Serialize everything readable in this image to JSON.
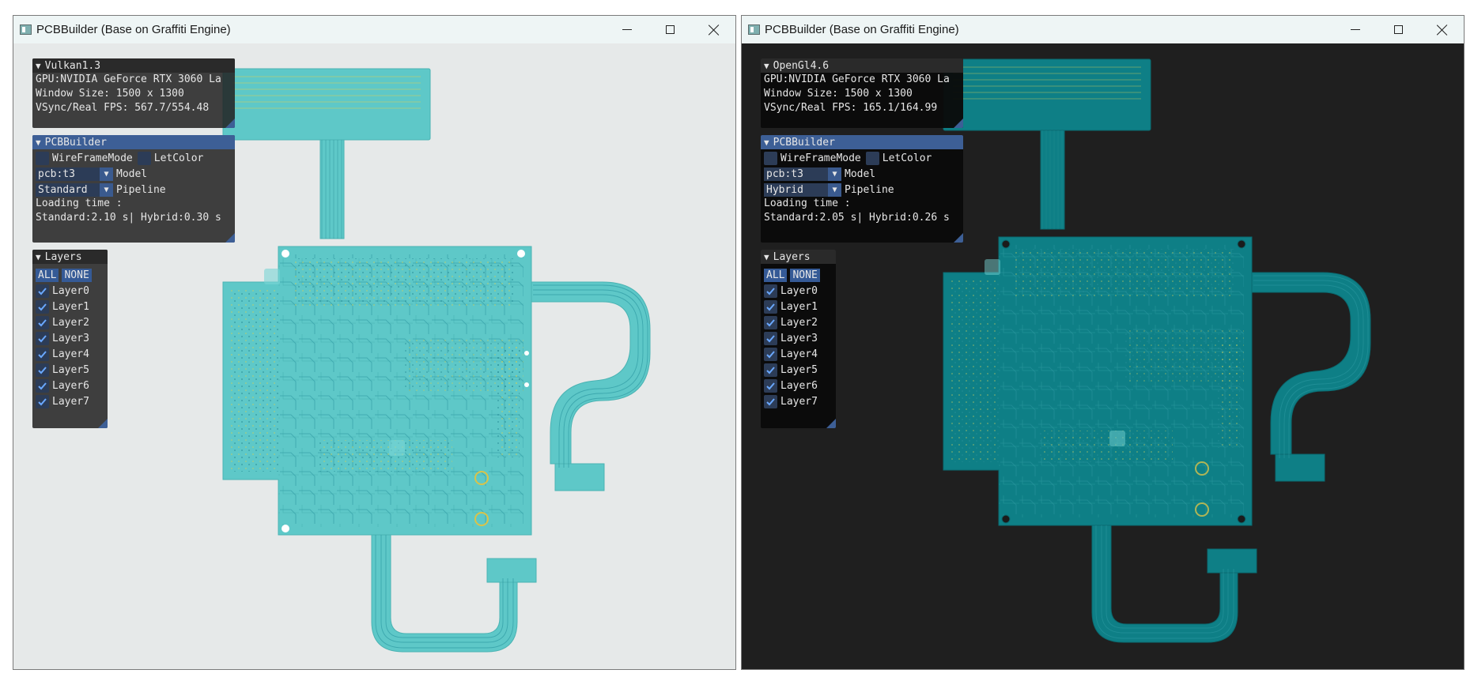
{
  "windows": [
    {
      "title": "PCBBuilder (Base on Graffiti Engine)",
      "theme": "light",
      "backend_panel": {
        "title": "Vulkan1.3",
        "gpu": "GPU:NVIDIA GeForce RTX 3060 La",
        "window_size": "Window Size: 1500 x 1300",
        "fps": "VSync/Real FPS: 567.7/554.48"
      },
      "pcb_panel": {
        "title": "PCBBuilder",
        "wireframe_label": "WireFrameMode",
        "letcolor_label": "LetColor",
        "model_value": "pcb:t3",
        "model_label": "Model",
        "pipeline_value": "Standard",
        "pipeline_label": "Pipeline",
        "loading_label": "Loading time :",
        "loading_value": "Standard:2.10 s| Hybrid:0.30 s"
      },
      "layers_panel": {
        "title": "Layers",
        "all_label": "ALL",
        "none_label": "NONE",
        "layers": [
          "Layer0",
          "Layer1",
          "Layer2",
          "Layer3",
          "Layer4",
          "Layer5",
          "Layer6",
          "Layer7"
        ]
      }
    },
    {
      "title": "PCBBuilder (Base on Graffiti Engine)",
      "theme": "dark",
      "backend_panel": {
        "title": "OpenGl4.6",
        "gpu": "GPU:NVIDIA GeForce RTX 3060 La",
        "window_size": "Window Size: 1500 x 1300",
        "fps": "VSync/Real FPS: 165.1/164.99"
      },
      "pcb_panel": {
        "title": "PCBBuilder",
        "wireframe_label": "WireFrameMode",
        "letcolor_label": "LetColor",
        "model_value": "pcb:t3",
        "model_label": "Model",
        "pipeline_value": "Hybrid",
        "pipeline_label": "Pipeline",
        "loading_label": "Loading time :",
        "loading_value": "Standard:2.05 s| Hybrid:0.26 s"
      },
      "layers_panel": {
        "title": "Layers",
        "all_label": "ALL",
        "none_label": "NONE",
        "layers": [
          "Layer0",
          "Layer1",
          "Layer2",
          "Layer3",
          "Layer4",
          "Layer5",
          "Layer6",
          "Layer7"
        ]
      }
    }
  ],
  "colors": {
    "left_viewport_bg": "#e6e9e9",
    "right_viewport_bg": "#1f1f1f",
    "pcb_light": "#5ec8c8",
    "pcb_dark": "#0e7f86",
    "imgui_header_blue": "#3d5f96",
    "imgui_frame": "#2c3c57",
    "checkmark": "#6aa8ff"
  }
}
